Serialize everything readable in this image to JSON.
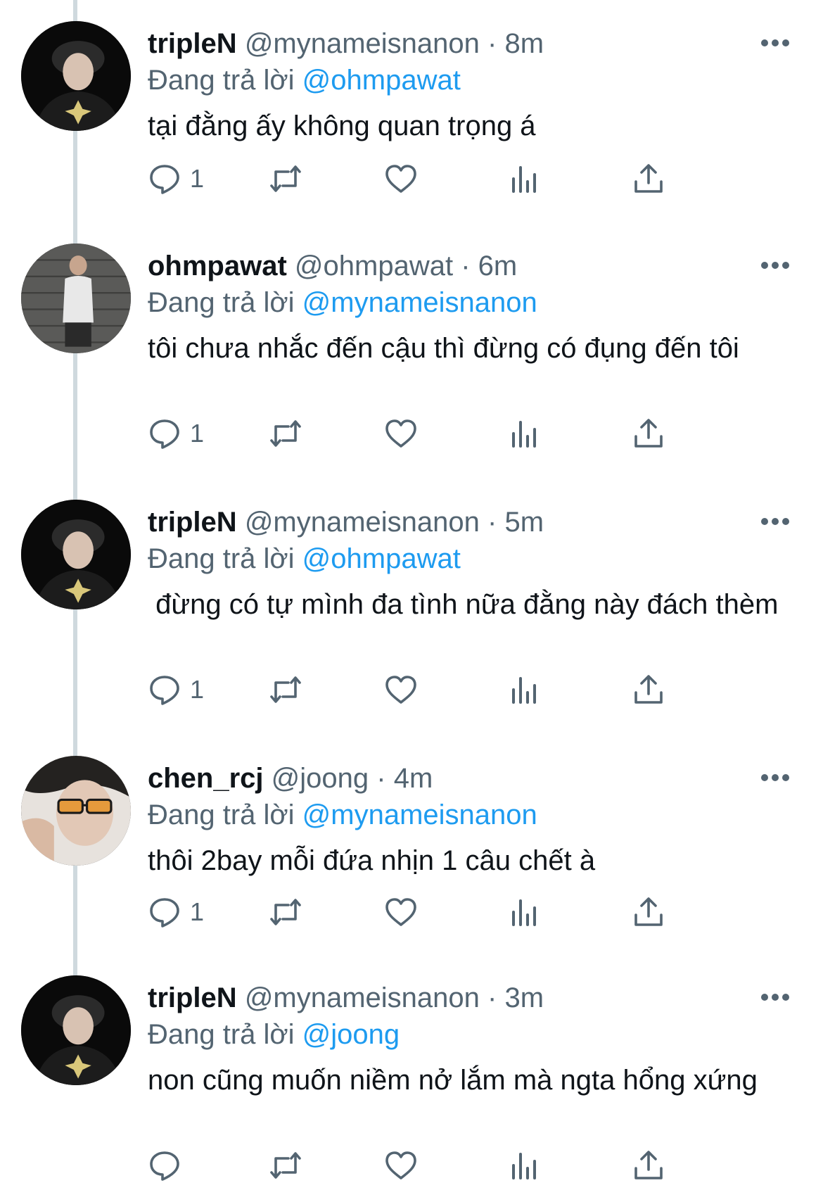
{
  "tweets": [
    {
      "name": "tripleN",
      "handle": "@mynameisnanon",
      "separator": "·",
      "time": "8m",
      "reply_prefix": "Đang trả lời",
      "reply_to": "@ohmpawat",
      "text": "tại đằng ấy không quan trọng á",
      "reply_count": "1",
      "avatar": "avatar-tripleN"
    },
    {
      "name": "ohmpawat",
      "handle": "@ohmpawat",
      "separator": "·",
      "time": "6m",
      "reply_prefix": "Đang trả lời",
      "reply_to": "@mynameisnanon",
      "text": "tôi chưa nhắc đến cậu thì đừng có đụng đến tôi",
      "reply_count": "1",
      "avatar": "avatar-ohmpawat"
    },
    {
      "name": "tripleN",
      "handle": "@mynameisnanon",
      "separator": "·",
      "time": "5m",
      "reply_prefix": "Đang trả lời",
      "reply_to": "@ohmpawat",
      "text": " đừng có tự mình đa tình nữa đằng này đách thèm",
      "reply_count": "1",
      "avatar": "avatar-tripleN"
    },
    {
      "name": "chen_rcj",
      "handle": "@joong",
      "separator": "·",
      "time": "4m",
      "reply_prefix": "Đang trả lời",
      "reply_to": "@mynameisnanon",
      "text": "thôi 2bay mỗi đứa nhịn 1 câu chết à",
      "reply_count": "1",
      "avatar": "avatar-chen"
    },
    {
      "name": "tripleN",
      "handle": "@mynameisnanon",
      "separator": "·",
      "time": "3m",
      "reply_prefix": "Đang trả lời",
      "reply_to": "@joong",
      "text": "non cũng muốn niềm nở lắm mà ngta hổng xứng",
      "reply_count": "",
      "avatar": "avatar-tripleN"
    }
  ],
  "icons": {
    "reply": "reply-icon",
    "retweet": "retweet-icon",
    "like": "like-icon",
    "views": "views-icon",
    "share": "share-icon",
    "more": "more-icon"
  },
  "colors": {
    "text": "#0f1419",
    "secondary": "#536471",
    "mention": "#1d9bf0",
    "thread_line": "#cfd9de"
  }
}
